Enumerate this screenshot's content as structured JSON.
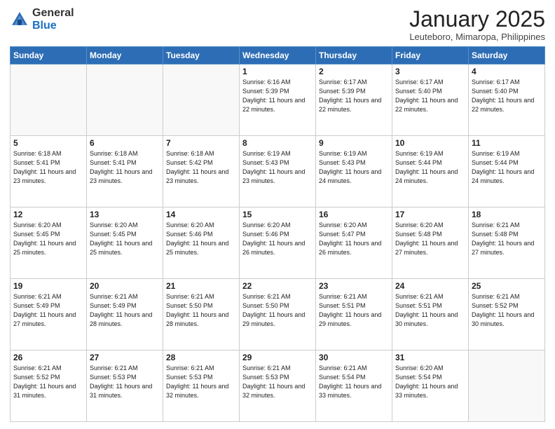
{
  "logo": {
    "general": "General",
    "blue": "Blue"
  },
  "title": "January 2025",
  "location": "Leuteboro, Mimaropa, Philippines",
  "days_of_week": [
    "Sunday",
    "Monday",
    "Tuesday",
    "Wednesday",
    "Thursday",
    "Friday",
    "Saturday"
  ],
  "weeks": [
    [
      {
        "day": "",
        "sunrise": "",
        "sunset": "",
        "daylight": ""
      },
      {
        "day": "",
        "sunrise": "",
        "sunset": "",
        "daylight": ""
      },
      {
        "day": "",
        "sunrise": "",
        "sunset": "",
        "daylight": ""
      },
      {
        "day": "1",
        "sunrise": "Sunrise: 6:16 AM",
        "sunset": "Sunset: 5:39 PM",
        "daylight": "Daylight: 11 hours and 22 minutes."
      },
      {
        "day": "2",
        "sunrise": "Sunrise: 6:17 AM",
        "sunset": "Sunset: 5:39 PM",
        "daylight": "Daylight: 11 hours and 22 minutes."
      },
      {
        "day": "3",
        "sunrise": "Sunrise: 6:17 AM",
        "sunset": "Sunset: 5:40 PM",
        "daylight": "Daylight: 11 hours and 22 minutes."
      },
      {
        "day": "4",
        "sunrise": "Sunrise: 6:17 AM",
        "sunset": "Sunset: 5:40 PM",
        "daylight": "Daylight: 11 hours and 22 minutes."
      }
    ],
    [
      {
        "day": "5",
        "sunrise": "Sunrise: 6:18 AM",
        "sunset": "Sunset: 5:41 PM",
        "daylight": "Daylight: 11 hours and 23 minutes."
      },
      {
        "day": "6",
        "sunrise": "Sunrise: 6:18 AM",
        "sunset": "Sunset: 5:41 PM",
        "daylight": "Daylight: 11 hours and 23 minutes."
      },
      {
        "day": "7",
        "sunrise": "Sunrise: 6:18 AM",
        "sunset": "Sunset: 5:42 PM",
        "daylight": "Daylight: 11 hours and 23 minutes."
      },
      {
        "day": "8",
        "sunrise": "Sunrise: 6:19 AM",
        "sunset": "Sunset: 5:43 PM",
        "daylight": "Daylight: 11 hours and 23 minutes."
      },
      {
        "day": "9",
        "sunrise": "Sunrise: 6:19 AM",
        "sunset": "Sunset: 5:43 PM",
        "daylight": "Daylight: 11 hours and 24 minutes."
      },
      {
        "day": "10",
        "sunrise": "Sunrise: 6:19 AM",
        "sunset": "Sunset: 5:44 PM",
        "daylight": "Daylight: 11 hours and 24 minutes."
      },
      {
        "day": "11",
        "sunrise": "Sunrise: 6:19 AM",
        "sunset": "Sunset: 5:44 PM",
        "daylight": "Daylight: 11 hours and 24 minutes."
      }
    ],
    [
      {
        "day": "12",
        "sunrise": "Sunrise: 6:20 AM",
        "sunset": "Sunset: 5:45 PM",
        "daylight": "Daylight: 11 hours and 25 minutes."
      },
      {
        "day": "13",
        "sunrise": "Sunrise: 6:20 AM",
        "sunset": "Sunset: 5:45 PM",
        "daylight": "Daylight: 11 hours and 25 minutes."
      },
      {
        "day": "14",
        "sunrise": "Sunrise: 6:20 AM",
        "sunset": "Sunset: 5:46 PM",
        "daylight": "Daylight: 11 hours and 25 minutes."
      },
      {
        "day": "15",
        "sunrise": "Sunrise: 6:20 AM",
        "sunset": "Sunset: 5:46 PM",
        "daylight": "Daylight: 11 hours and 26 minutes."
      },
      {
        "day": "16",
        "sunrise": "Sunrise: 6:20 AM",
        "sunset": "Sunset: 5:47 PM",
        "daylight": "Daylight: 11 hours and 26 minutes."
      },
      {
        "day": "17",
        "sunrise": "Sunrise: 6:20 AM",
        "sunset": "Sunset: 5:48 PM",
        "daylight": "Daylight: 11 hours and 27 minutes."
      },
      {
        "day": "18",
        "sunrise": "Sunrise: 6:21 AM",
        "sunset": "Sunset: 5:48 PM",
        "daylight": "Daylight: 11 hours and 27 minutes."
      }
    ],
    [
      {
        "day": "19",
        "sunrise": "Sunrise: 6:21 AM",
        "sunset": "Sunset: 5:49 PM",
        "daylight": "Daylight: 11 hours and 27 minutes."
      },
      {
        "day": "20",
        "sunrise": "Sunrise: 6:21 AM",
        "sunset": "Sunset: 5:49 PM",
        "daylight": "Daylight: 11 hours and 28 minutes."
      },
      {
        "day": "21",
        "sunrise": "Sunrise: 6:21 AM",
        "sunset": "Sunset: 5:50 PM",
        "daylight": "Daylight: 11 hours and 28 minutes."
      },
      {
        "day": "22",
        "sunrise": "Sunrise: 6:21 AM",
        "sunset": "Sunset: 5:50 PM",
        "daylight": "Daylight: 11 hours and 29 minutes."
      },
      {
        "day": "23",
        "sunrise": "Sunrise: 6:21 AM",
        "sunset": "Sunset: 5:51 PM",
        "daylight": "Daylight: 11 hours and 29 minutes."
      },
      {
        "day": "24",
        "sunrise": "Sunrise: 6:21 AM",
        "sunset": "Sunset: 5:51 PM",
        "daylight": "Daylight: 11 hours and 30 minutes."
      },
      {
        "day": "25",
        "sunrise": "Sunrise: 6:21 AM",
        "sunset": "Sunset: 5:52 PM",
        "daylight": "Daylight: 11 hours and 30 minutes."
      }
    ],
    [
      {
        "day": "26",
        "sunrise": "Sunrise: 6:21 AM",
        "sunset": "Sunset: 5:52 PM",
        "daylight": "Daylight: 11 hours and 31 minutes."
      },
      {
        "day": "27",
        "sunrise": "Sunrise: 6:21 AM",
        "sunset": "Sunset: 5:53 PM",
        "daylight": "Daylight: 11 hours and 31 minutes."
      },
      {
        "day": "28",
        "sunrise": "Sunrise: 6:21 AM",
        "sunset": "Sunset: 5:53 PM",
        "daylight": "Daylight: 11 hours and 32 minutes."
      },
      {
        "day": "29",
        "sunrise": "Sunrise: 6:21 AM",
        "sunset": "Sunset: 5:53 PM",
        "daylight": "Daylight: 11 hours and 32 minutes."
      },
      {
        "day": "30",
        "sunrise": "Sunrise: 6:21 AM",
        "sunset": "Sunset: 5:54 PM",
        "daylight": "Daylight: 11 hours and 33 minutes."
      },
      {
        "day": "31",
        "sunrise": "Sunrise: 6:20 AM",
        "sunset": "Sunset: 5:54 PM",
        "daylight": "Daylight: 11 hours and 33 minutes."
      },
      {
        "day": "",
        "sunrise": "",
        "sunset": "",
        "daylight": ""
      }
    ]
  ]
}
